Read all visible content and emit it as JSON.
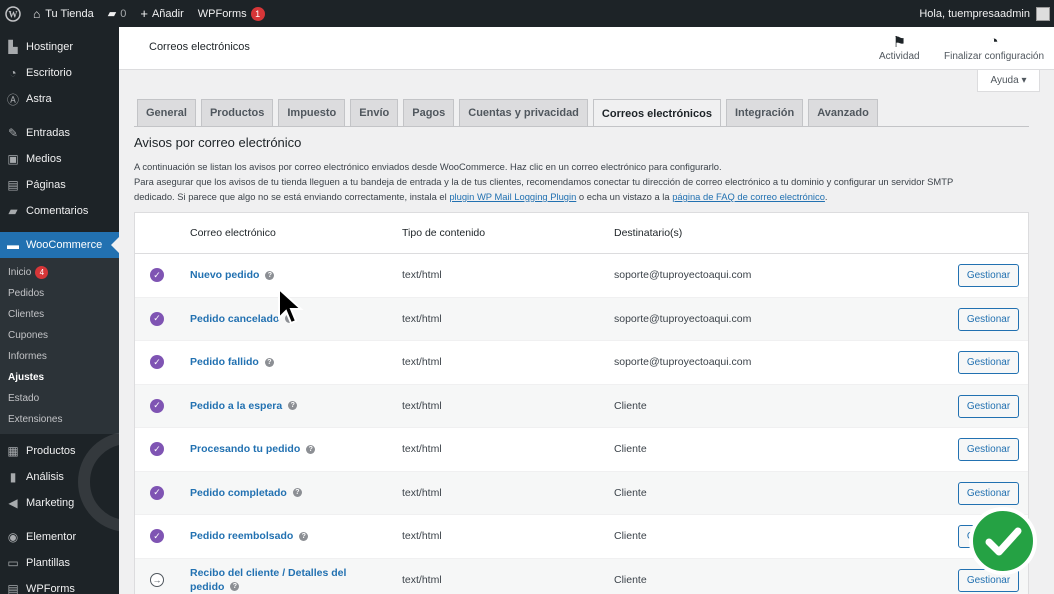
{
  "admin_bar": {
    "site_name": "Tu Tienda",
    "comments_count": "0",
    "new_label": "Añadir",
    "wpforms_label": "WPForms",
    "wpforms_badge": "1",
    "greeting": "Hola, tuempresaadmin"
  },
  "sidebar": {
    "items_top": [
      {
        "label": "Hostinger",
        "icon": "hostinger-icon"
      },
      {
        "label": "Escritorio",
        "icon": "dashboard-icon"
      },
      {
        "label": "Astra",
        "icon": "astra-icon"
      },
      {
        "label": "Entradas",
        "icon": "pin-icon"
      },
      {
        "label": "Medios",
        "icon": "media-icon"
      },
      {
        "label": "Páginas",
        "icon": "pages-icon"
      },
      {
        "label": "Comentarios",
        "icon": "comments-icon"
      }
    ],
    "current": {
      "label": "WooCommerce",
      "icon": "woocommerce-icon"
    },
    "submenu": [
      {
        "label": "Inicio",
        "badge": "4"
      },
      {
        "label": "Pedidos"
      },
      {
        "label": "Clientes"
      },
      {
        "label": "Cupones"
      },
      {
        "label": "Informes"
      },
      {
        "label": "Ajustes",
        "active": true
      },
      {
        "label": "Estado"
      },
      {
        "label": "Extensiones"
      }
    ],
    "items_bottom": [
      {
        "label": "Productos",
        "icon": "products-icon"
      },
      {
        "label": "Análisis",
        "icon": "analytics-icon"
      },
      {
        "label": "Marketing",
        "icon": "megaphone-icon"
      },
      {
        "label": "Elementor",
        "icon": "elementor-icon"
      },
      {
        "label": "Plantillas",
        "icon": "folder-icon"
      },
      {
        "label": "WPForms",
        "icon": "wpforms-icon"
      }
    ]
  },
  "header": {
    "title": "Correos electrónicos",
    "activity_label": "Actividad",
    "finish_label": "Finalizar configuración",
    "help_label": "Ayuda ▾"
  },
  "tabs": [
    "General",
    "Productos",
    "Impuesto",
    "Envío",
    "Pagos",
    "Cuentas y privacidad",
    "Correos electrónicos",
    "Integración",
    "Avanzado"
  ],
  "active_tab": "Correos electrónicos",
  "section": {
    "title": "Avisos por correo electrónico",
    "line1": "A continuación se listan los avisos por correo electrónico enviados desde WooCommerce. Haz clic en un correo electrónico para configurarlo.",
    "line2": "Para asegurar que los avisos de tu tienda lleguen a tu bandeja de entrada y la de tus clientes, recomendamos conectar tu dirección de correo electrónico a tu dominio y configurar un servidor SMTP",
    "line3_a": "dedicado. Si parece que algo no se está enviando correctamente, instala el ",
    "link1": "plugin WP Mail Logging Plugin",
    "line3_b": " o echa un vistazo a la ",
    "link2": "página de FAQ de correo electrónico",
    "line3_c": "."
  },
  "table": {
    "headers": {
      "email": "Correo electrónico",
      "content_type": "Tipo de contenido",
      "recipient": "Destinatario(s)"
    },
    "manage_label": "Gestionar",
    "rows": [
      {
        "name": "Nuevo pedido",
        "content_type": "text/html",
        "recipient": "soporte@tuproyectoaqui.com",
        "enabled": true
      },
      {
        "name": "Pedido cancelado",
        "content_type": "text/html",
        "recipient": "soporte@tuproyectoaqui.com",
        "enabled": true
      },
      {
        "name": "Pedido fallido",
        "content_type": "text/html",
        "recipient": "soporte@tuproyectoaqui.com",
        "enabled": true
      },
      {
        "name": "Pedido a la espera",
        "content_type": "text/html",
        "recipient": "Cliente",
        "enabled": true
      },
      {
        "name": "Procesando tu pedido",
        "content_type": "text/html",
        "recipient": "Cliente",
        "enabled": true
      },
      {
        "name": "Pedido completado",
        "content_type": "text/html",
        "recipient": "Cliente",
        "enabled": true
      },
      {
        "name": "Pedido reembolsado",
        "content_type": "text/html",
        "recipient": "Cliente",
        "enabled": true
      },
      {
        "name": "Recibo del cliente / Detalles del pedido",
        "content_type": "text/html",
        "recipient": "Cliente",
        "enabled": false
      }
    ]
  },
  "colors": {
    "accent": "#2271b1",
    "woo_purple": "#7f54b3",
    "admin_dark": "#1d2327",
    "success_green": "#25a244"
  }
}
